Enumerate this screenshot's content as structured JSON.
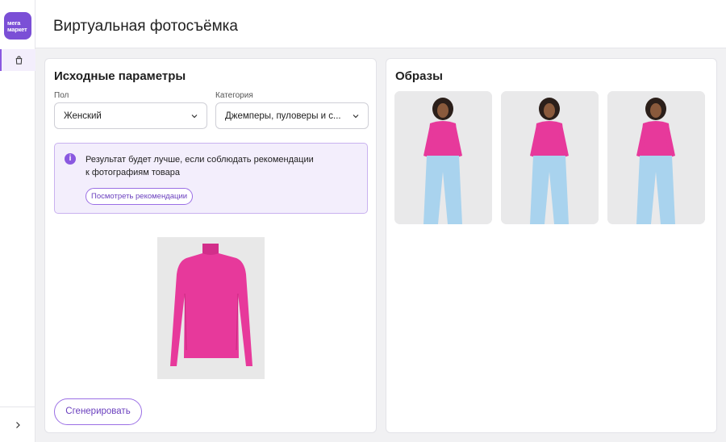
{
  "logo": {
    "line1": "мега",
    "line2": "маркет"
  },
  "header": {
    "title": "Виртуальная фотосъёмка"
  },
  "left_card": {
    "title": "Исходные параметры",
    "gender": {
      "label": "Пол",
      "value": "Женский"
    },
    "category": {
      "label": "Категория",
      "value": "Джемперы, пуловеры и с..."
    },
    "notice": {
      "line1": "Результат будет лучше, если соблюдать рекомендации",
      "line2": "к фотографиям товара",
      "button": "Посмотреть рекомендации"
    },
    "generate_button": "Сгенерировать"
  },
  "right_card": {
    "title": "Образы"
  },
  "colors": {
    "accent": "#8a58e0",
    "sweater": "#e7399b",
    "jeans": "#a9d3ee"
  }
}
